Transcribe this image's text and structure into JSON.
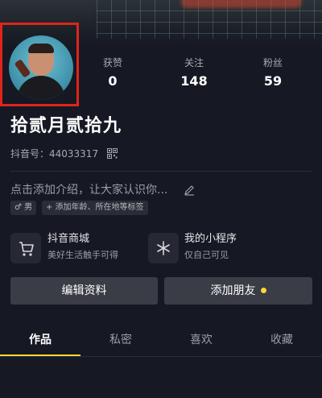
{
  "colors": {
    "background": "#161823",
    "accent": "#fdd637",
    "highlight_box": "#e0241b",
    "button_bg": "#3a3c46"
  },
  "profile": {
    "name": "拾贰月贰拾九",
    "douyin_id": "抖音号：44033317",
    "bio_placeholder": "点击添加介绍，让大家认识你...",
    "gender_tag": "♂ 男",
    "add_tags": "+ 添加年龄、所在地等标签"
  },
  "stats": [
    {
      "label": "获赞",
      "value": "0"
    },
    {
      "label": "关注",
      "value": "148"
    },
    {
      "label": "粉丝",
      "value": "59"
    }
  ],
  "cards": [
    {
      "icon": "cart-icon",
      "title": "抖音商城",
      "subtitle": "美好生活触手可得"
    },
    {
      "icon": "mini-program-icon",
      "title": "我的小程序",
      "subtitle": "仅自己可见"
    }
  ],
  "buttons": {
    "edit": "编辑资料",
    "add_friend": "添加朋友"
  },
  "tabs": [
    {
      "label": "作品"
    },
    {
      "label": "私密"
    },
    {
      "label": "喜欢"
    },
    {
      "label": "收藏"
    }
  ]
}
